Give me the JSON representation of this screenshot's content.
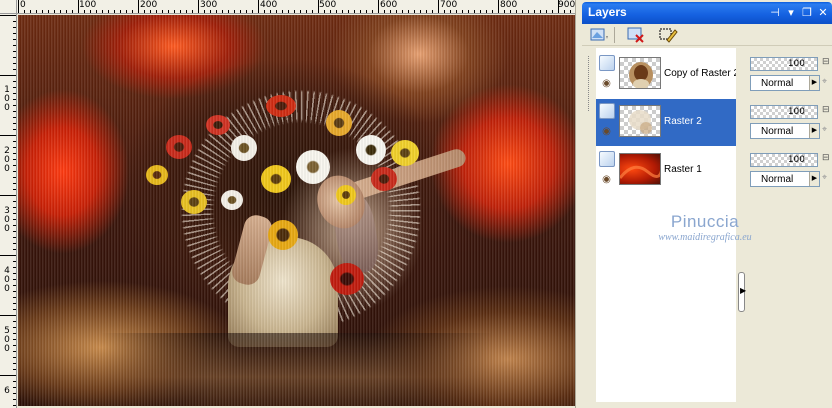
{
  "ruler_top": [
    "0",
    "100",
    "200",
    "300",
    "400",
    "500",
    "600",
    "700",
    "800",
    "900"
  ],
  "ruler_left": [
    "1\n0\n0",
    "2\n0\n0",
    "3\n0\n0",
    "4\n0\n0",
    "5\n0\n0",
    "6"
  ],
  "layers_palette": {
    "title": "Layers",
    "title_buttons": {
      "pin": "⊣",
      "dropdown": "▾",
      "restore": "❐",
      "close": "✕"
    },
    "layers": [
      {
        "name": "Copy of Raster 2",
        "opacity": "100",
        "blend_mode": "Normal",
        "selected": false,
        "thumb": "portrait"
      },
      {
        "name": "Raster 2",
        "opacity": "100",
        "blend_mode": "Normal",
        "selected": true,
        "thumb": "transparent"
      },
      {
        "name": "Raster 1",
        "opacity": "100",
        "blend_mode": "Normal",
        "selected": false,
        "thumb": "red-gradient"
      }
    ]
  },
  "watermark": {
    "title": "Pinuccia",
    "url": "www.maidiregrafica.eu"
  },
  "colors": {
    "titlebar": "#0a5cdc",
    "selected_row": "#316ac5",
    "accent_red": "#d42a08"
  }
}
